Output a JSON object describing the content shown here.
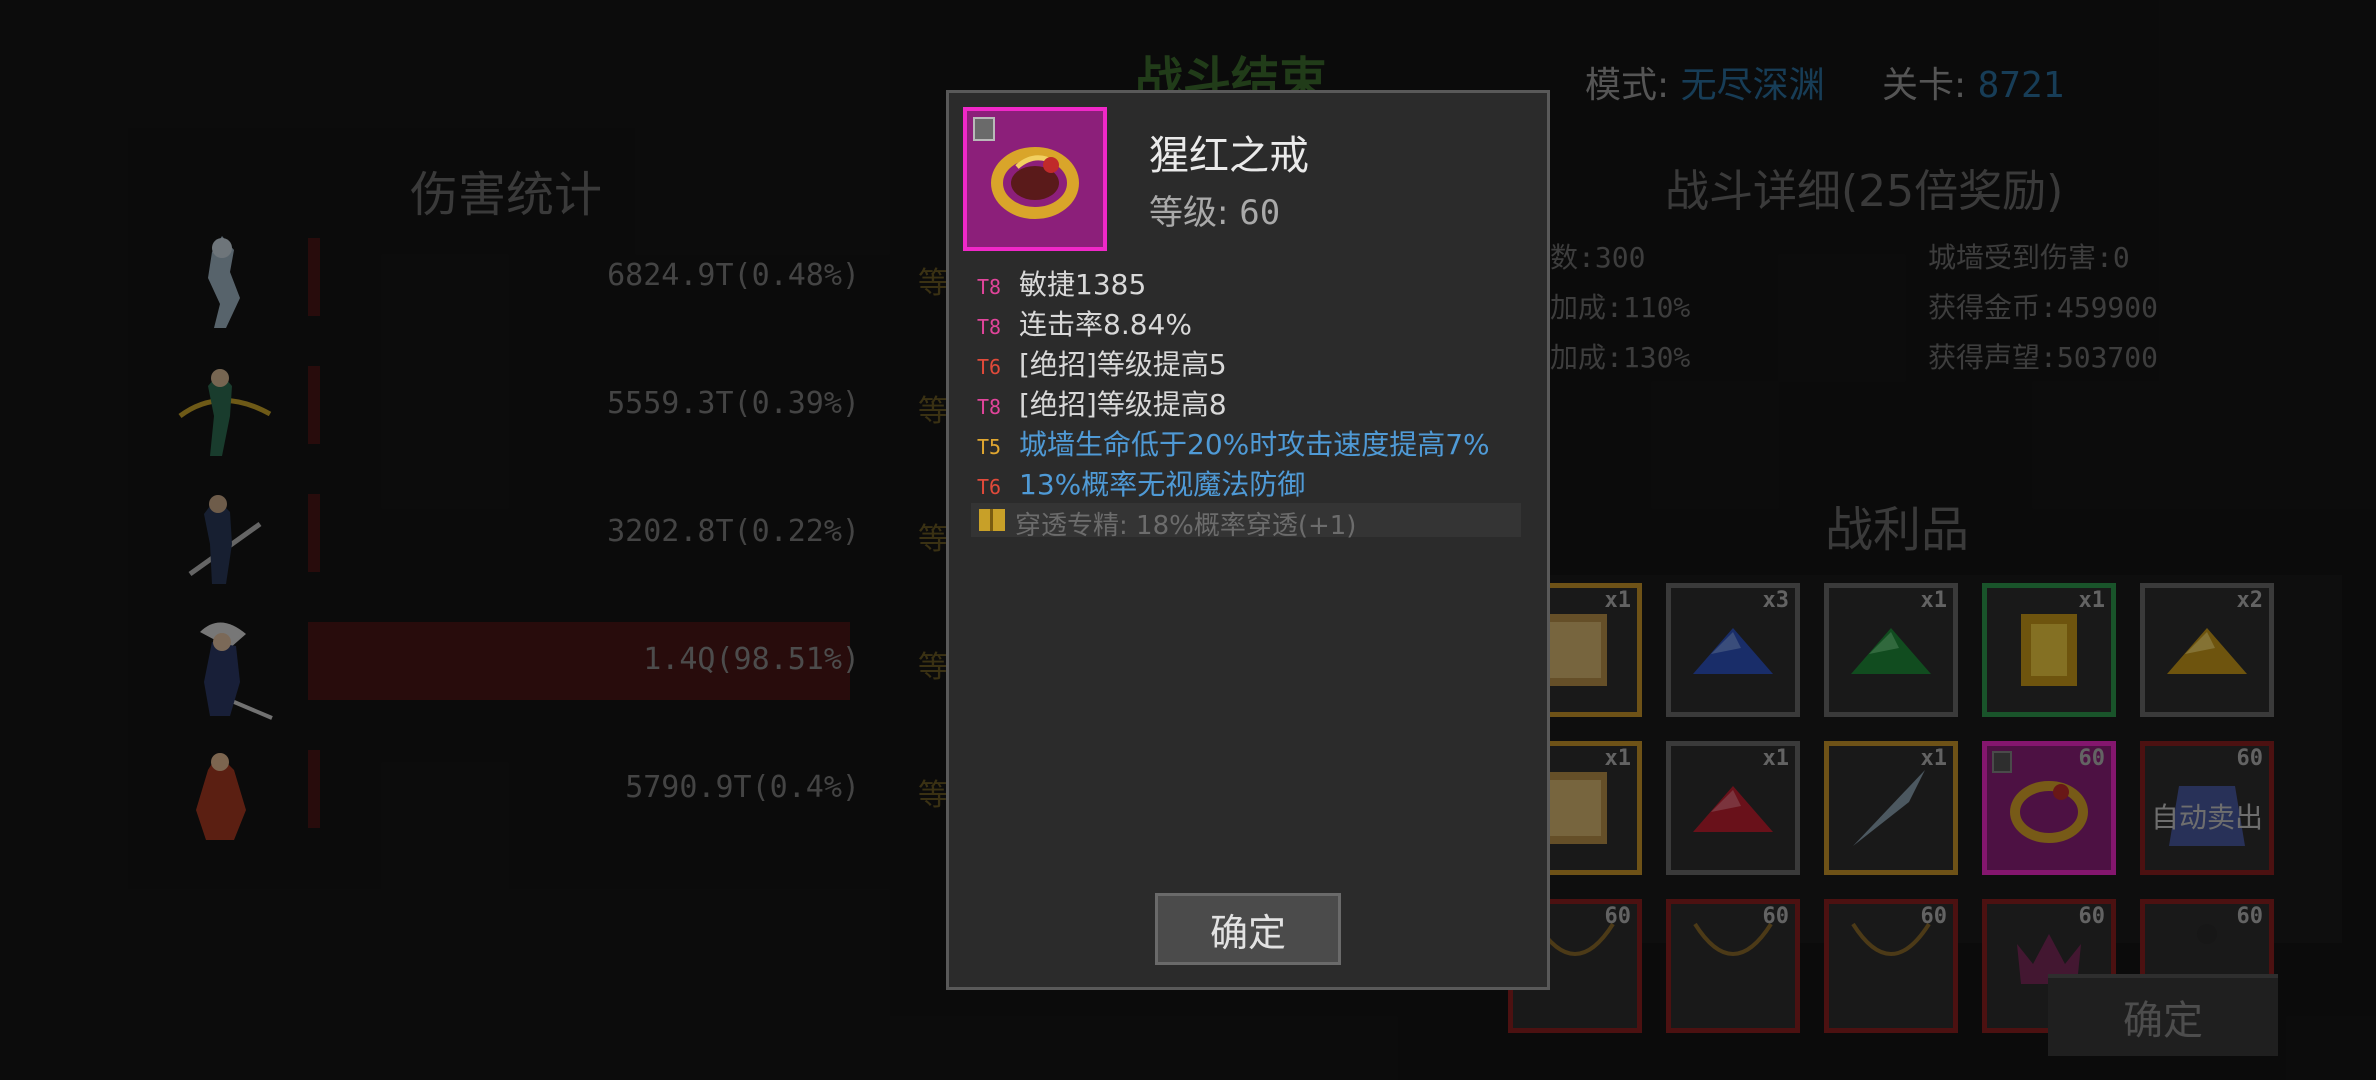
{
  "header": {
    "title": "战斗结束",
    "mode_label": "模式:",
    "mode_value": "无尽深渊",
    "stage_label": "关卡:",
    "stage_value": "8721"
  },
  "damage": {
    "title": "伤害统计",
    "rows": [
      {
        "value": "6824.9T(0.48%)",
        "share": 0.48,
        "side": "等"
      },
      {
        "value": "5559.3T(0.39%)",
        "share": 0.39,
        "side": "等"
      },
      {
        "value": "3202.8T(0.22%)",
        "share": 0.22,
        "side": "等"
      },
      {
        "value": "1.4Q(98.51%)",
        "share": 98.51,
        "side": "等"
      },
      {
        "value": "5790.9T(0.4%)",
        "share": 0.4,
        "side": "等"
      }
    ]
  },
  "details": {
    "title": "战斗详细(25倍奖励)",
    "left": [
      "数:300",
      "加成:110%",
      "加成:130%"
    ],
    "right": [
      "城墙受到伤害:0",
      "获得金币:459900",
      "获得声望:503700"
    ]
  },
  "loot": {
    "title": "战利品",
    "slots": [
      {
        "count": "x1",
        "kind": "scroll",
        "border": "#c8962a"
      },
      {
        "count": "x3",
        "kind": "blue-gem",
        "border": "#6a6a6a"
      },
      {
        "count": "x1",
        "kind": "green-gem",
        "border": "#6a6a6a"
      },
      {
        "count": "x1",
        "kind": "gold-tome",
        "border": "#2e9a4e"
      },
      {
        "count": "x2",
        "kind": "yellow-gem",
        "border": "#6a6a6a"
      },
      {
        "count": "x1",
        "kind": "scroll",
        "border": "#c8962a"
      },
      {
        "count": "x1",
        "kind": "red-gem",
        "border": "#6a6a6a"
      },
      {
        "count": "x1",
        "kind": "feather",
        "border": "#c8962a"
      },
      {
        "count": "60",
        "kind": "ring",
        "border": "#f028c8"
      },
      {
        "count": "60",
        "kind": "bag",
        "border": "#8a1f1f",
        "label": "自动卖出"
      },
      {
        "count": "60",
        "kind": "necklace",
        "border": "#8a1f1f"
      },
      {
        "count": "60",
        "kind": "necklace",
        "border": "#8a1f1f"
      },
      {
        "count": "60",
        "kind": "necklace",
        "border": "#8a1f1f"
      },
      {
        "count": "60",
        "kind": "crown",
        "border": "#8a1f1f"
      },
      {
        "count": "60",
        "kind": "amulet",
        "border": "#8a1f1f"
      }
    ]
  },
  "confirm_label": "确定",
  "modal": {
    "item_name": "猩红之戒",
    "level_label": "等级:",
    "level_value": "60",
    "attributes": [
      {
        "tier": "T8",
        "text": "敏捷1385",
        "style": "normal",
        "tier_color": "pink"
      },
      {
        "tier": "T8",
        "text": "连击率8.84%",
        "style": "normal",
        "tier_color": "pink"
      },
      {
        "tier": "T6",
        "text": "[绝招]等级提高5",
        "style": "normal",
        "tier_color": "red"
      },
      {
        "tier": "T8",
        "text": "[绝招]等级提高8",
        "style": "normal",
        "tier_color": "pink"
      },
      {
        "tier": "T5",
        "text": "城墙生命低于20%时攻击速度提高7%",
        "style": "blue",
        "tier_color": "yellow"
      },
      {
        "tier": "T6",
        "text": "13%概率无视魔法防御",
        "style": "blue",
        "tier_color": "red"
      }
    ],
    "set_bonus": "穿透专精: 18%概率穿透(+1)",
    "confirm_label": "确定"
  },
  "colors": {
    "rarity_magenta": "#f028c8",
    "title_green": "#3d6e2e",
    "value_blue": "#2b6f9e",
    "attr_blue": "#4f9ad6"
  }
}
